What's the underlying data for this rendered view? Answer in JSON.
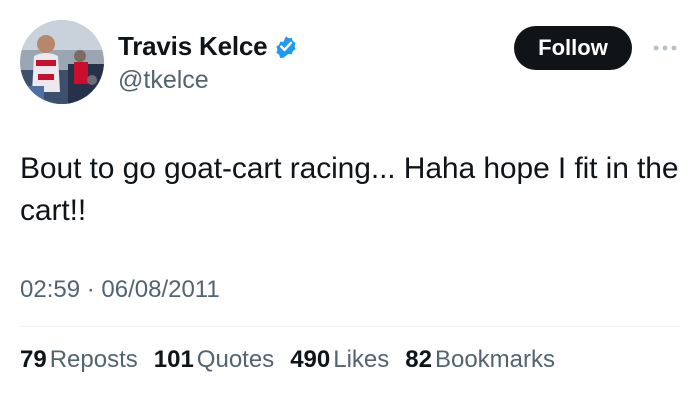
{
  "author": {
    "display_name": "Travis Kelce",
    "handle": "@tkelce",
    "verified": true,
    "avatar_icon": "profile-photo"
  },
  "actions": {
    "follow_label": "Follow",
    "more_icon": "more-dots-icon"
  },
  "tweet": {
    "text": "Bout to go goat-cart racing... Haha hope I fit in the cart!!",
    "timestamp": "02:59 · 06/08/2011"
  },
  "stats": [
    {
      "count": "79",
      "label": "Reposts"
    },
    {
      "count": "101",
      "label": "Quotes"
    },
    {
      "count": "490",
      "label": "Likes"
    },
    {
      "count": "82",
      "label": "Bookmarks"
    }
  ],
  "colors": {
    "text_primary": "#0f1419",
    "text_secondary": "#536471",
    "follow_bg": "#0f1419",
    "verified_blue": "#1d9bf0",
    "divider": "#eff3f4"
  }
}
